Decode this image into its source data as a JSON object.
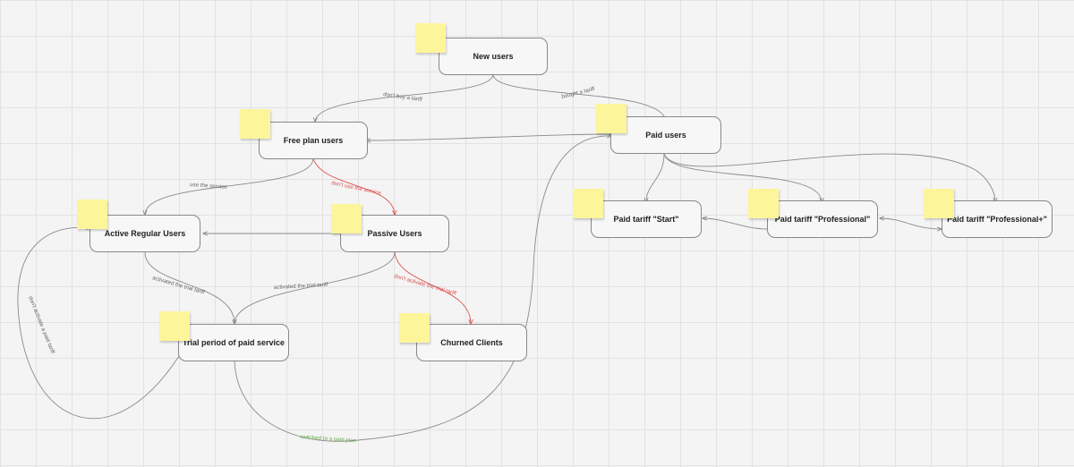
{
  "colors": {
    "edge": "#8a8a8a",
    "edge_negative": "#d9534f",
    "edge_positive": "#6aa84f",
    "sticky": "#fdf59a",
    "node_fill": "#f7f7f7",
    "node_border": "#888888"
  },
  "nodes": {
    "new_users": "New users",
    "free_plan_users": "Free plan users",
    "paid_users": "Paid users",
    "active_regular_users": "Active Regular Users",
    "passive_users": "Passive Users",
    "trial_period": "Trial period of paid service",
    "churned_clients": "Churned Clients",
    "tariff_start": "Paid tariff \"Start\"",
    "tariff_professional": "Paid tariff \"Professional\"",
    "tariff_professional_plus": "Paid tariff \"Professional+\""
  },
  "edges": {
    "dont_buy_tariff": "don't buy a tariff",
    "bought_tariff": "bought a tariff",
    "use_service": "use the service",
    "dont_use_service": "don't use the service",
    "activated_trial_1": "activated the trial tariff",
    "activated_trial_2": "activated the trial tariff",
    "dont_activate_trial": "don't activate the trial tariff",
    "dont_activate_paid": "don't activate a paid tariff",
    "switched_paid_plan": "switched to a paid plan"
  }
}
